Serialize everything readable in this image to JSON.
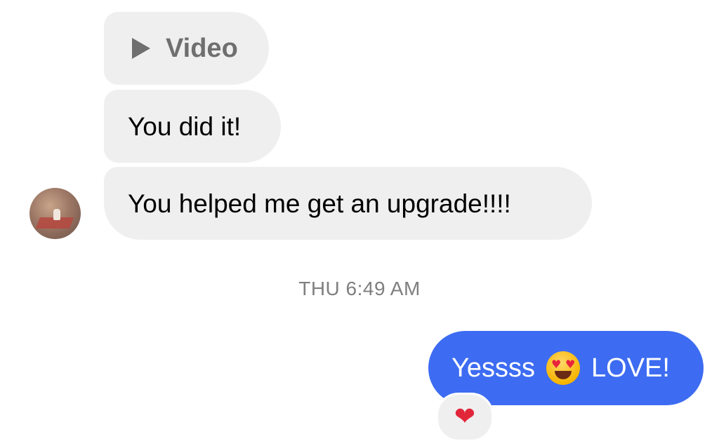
{
  "messages": {
    "video": {
      "label": "Video",
      "icon": "play-icon"
    },
    "did_it": {
      "text": "You did it!"
    },
    "upgrade": {
      "text": "You helped me get an upgrade!!!!"
    },
    "timestamp": "THU 6:49 AM",
    "sent": {
      "text_before": "Yessss",
      "emoji": "smiling-face-with-heart-eyes",
      "text_after": "LOVE!"
    },
    "reaction": {
      "glyph": "❤",
      "name": "red-heart"
    }
  },
  "colors": {
    "incoming_bubble": "#efefef",
    "outgoing_bubble": "#3d6cf2",
    "timestamp_text": "#7f7f7f",
    "reaction_heart": "#e2263a"
  }
}
